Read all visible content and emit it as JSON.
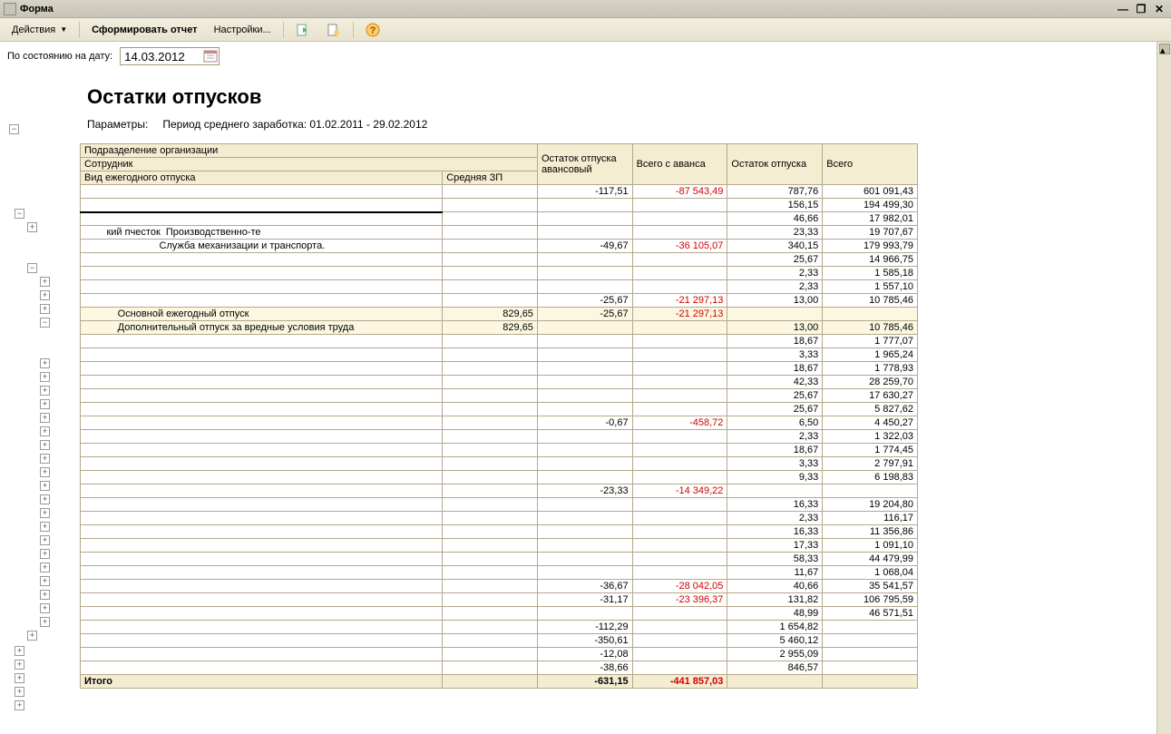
{
  "window": {
    "title": "Форма"
  },
  "toolbar": {
    "actions": "Действия",
    "generate": "Сформировать отчет",
    "settings": "Настройки..."
  },
  "dateRow": {
    "label": "По состоянию на дату:",
    "value": "14.03.2012"
  },
  "report": {
    "title": "Остатки отпусков",
    "paramsLabel": "Параметры:",
    "paramsText": "Период среднего заработка: 01.02.2011 - 29.02.2012",
    "header": {
      "r1c1": "Подразделение организации",
      "r1c2": "Остаток отпуска авансовый",
      "r1c3": "Всего с аванса",
      "r1c4": "Остаток отпуска",
      "r1c5": "Всего",
      "r2c1": "Сотрудник",
      "r3c1": "Вид ежегодного отпуска",
      "r3c2": "Средняя ЗП"
    },
    "rows": [
      {
        "name": "",
        "sp": "",
        "c1": "-117,51",
        "c2": "-87 543,49",
        "c2neg": true,
        "c3": "787,76",
        "c4": "601 091,43"
      },
      {
        "name": "",
        "sp": "",
        "c1": "",
        "c2": "",
        "c3": "156,15",
        "c4": "194 499,30",
        "thick": true
      },
      {
        "name": "",
        "sp": "",
        "c1": "",
        "c2": "",
        "c3": "46,66",
        "c4": "17 982,01"
      },
      {
        "name": "        кий пчесток  Производственно-те",
        "sp": "",
        "c1": "",
        "c2": "",
        "c3": "23,33",
        "c4": "19 707,67"
      },
      {
        "name": "                           Служба механизации и транспорта.",
        "sp": "",
        "c1": "-49,67",
        "c2": "-36 105,07",
        "c2neg": true,
        "c3": "340,15",
        "c4": "179 993,79"
      },
      {
        "name": "",
        "sp": "",
        "c1": "",
        "c2": "",
        "c3": "25,67",
        "c4": "14 966,75"
      },
      {
        "name": "",
        "sp": "",
        "c1": "",
        "c2": "",
        "c3": "2,33",
        "c4": "1 585,18"
      },
      {
        "name": "",
        "sp": "",
        "c1": "",
        "c2": "",
        "c3": "2,33",
        "c4": "1 557,10"
      },
      {
        "name": "",
        "sp": "",
        "c1": "-25,67",
        "c2": "-21 297,13",
        "c2neg": true,
        "c3": "13,00",
        "c4": "10 785,46"
      },
      {
        "name": "            Основной ежегодный отпуск",
        "sp": "829,65",
        "c1": "-25,67",
        "c2": "-21 297,13",
        "c2neg": true,
        "c3": "",
        "c4": "",
        "hl": true
      },
      {
        "name": "            Дополнительный отпуск за вредные условия труда",
        "sp": "829,65",
        "c1": "",
        "c2": "",
        "c3": "13,00",
        "c4": "10 785,46",
        "hl": true
      },
      {
        "name": "",
        "sp": "",
        "c1": "",
        "c2": "",
        "c3": "18,67",
        "c4": "1 777,07"
      },
      {
        "name": "",
        "sp": "",
        "c1": "",
        "c2": "",
        "c3": "3,33",
        "c4": "1 965,24"
      },
      {
        "name": "",
        "sp": "",
        "c1": "",
        "c2": "",
        "c3": "18,67",
        "c4": "1 778,93"
      },
      {
        "name": "",
        "sp": "",
        "c1": "",
        "c2": "",
        "c3": "42,33",
        "c4": "28 259,70"
      },
      {
        "name": "",
        "sp": "",
        "c1": "",
        "c2": "",
        "c3": "25,67",
        "c4": "17 630,27"
      },
      {
        "name": "",
        "sp": "",
        "c1": "",
        "c2": "",
        "c3": "25,67",
        "c4": "5 827,62"
      },
      {
        "name": "",
        "sp": "",
        "c1": "-0,67",
        "c2": "-458,72",
        "c2neg": true,
        "c3": "6,50",
        "c4": "4 450,27"
      },
      {
        "name": "",
        "sp": "",
        "c1": "",
        "c2": "",
        "c3": "2,33",
        "c4": "1 322,03"
      },
      {
        "name": "",
        "sp": "",
        "c1": "",
        "c2": "",
        "c3": "18,67",
        "c4": "1 774,45"
      },
      {
        "name": "",
        "sp": "",
        "c1": "",
        "c2": "",
        "c3": "3,33",
        "c4": "2 797,91"
      },
      {
        "name": "",
        "sp": "",
        "c1": "",
        "c2": "",
        "c3": "9,33",
        "c4": "6 198,83"
      },
      {
        "name": "",
        "sp": "",
        "c1": "-23,33",
        "c2": "-14 349,22",
        "c2neg": true,
        "c3": "",
        "c4": ""
      },
      {
        "name": "",
        "sp": "",
        "c1": "",
        "c2": "",
        "c3": "16,33",
        "c4": "19 204,80"
      },
      {
        "name": "",
        "sp": "",
        "c1": "",
        "c2": "",
        "c3": "2,33",
        "c4": "116,17"
      },
      {
        "name": "",
        "sp": "",
        "c1": "",
        "c2": "",
        "c3": "16,33",
        "c4": "11 356,86"
      },
      {
        "name": "",
        "sp": "",
        "c1": "",
        "c2": "",
        "c3": "17,33",
        "c4": "1 091,10"
      },
      {
        "name": "",
        "sp": "",
        "c1": "",
        "c2": "",
        "c3": "58,33",
        "c4": "44 479,99"
      },
      {
        "name": "",
        "sp": "",
        "c1": "",
        "c2": "",
        "c3": "11,67",
        "c4": "1 068,04"
      },
      {
        "name": "",
        "sp": "",
        "c1": "-36,67",
        "c2": "-28 042,05",
        "c2neg": true,
        "c3": "40,66",
        "c4": "35 541,57"
      },
      {
        "name": "",
        "sp": "",
        "c1": "-31,17",
        "c2": "-23 396,37",
        "c2neg": true,
        "c3": "131,82",
        "c4": "106 795,59"
      },
      {
        "name": "",
        "sp": "",
        "c1": "",
        "c2": "",
        "c3": "48,99",
        "c4": "46 571,51"
      },
      {
        "name": "",
        "sp": "",
        "c1": "-112,29",
        "c2": "",
        "c3": "1 654,82",
        "c4": ""
      },
      {
        "name": "",
        "sp": "",
        "c1": "-350,61",
        "c2": "",
        "c3": "5 460,12",
        "c4": ""
      },
      {
        "name": "",
        "sp": "",
        "c1": "-12,08",
        "c2": "",
        "c3": "2 955,09",
        "c4": ""
      },
      {
        "name": "",
        "sp": "",
        "c1": "-38,66",
        "c2": "",
        "c3": "846,57",
        "c4": ""
      }
    ],
    "itogo": {
      "name": "Итого",
      "c1": "-631,15",
      "c2": "-441 857,03",
      "c2neg": true,
      "c3": "",
      "c4": ""
    }
  },
  "tree": {
    "top": [
      {
        "s": "−",
        "t": 55
      }
    ],
    "l0": [
      {
        "s": "−",
        "t": 148
      },
      {
        "s": "+",
        "t": 630
      },
      {
        "s": "+",
        "t": 645
      },
      {
        "s": "+",
        "t": 660
      },
      {
        "s": "+",
        "t": 675
      },
      {
        "s": "+",
        "t": 690
      }
    ],
    "l1": [
      {
        "s": "+",
        "t": 163
      },
      {
        "s": "−",
        "t": 208
      },
      {
        "s": "+",
        "t": 613
      }
    ],
    "l2": [
      {
        "s": "+",
        "t": 223
      },
      {
        "s": "+",
        "t": 238
      },
      {
        "s": "+",
        "t": 253
      },
      {
        "s": "−",
        "t": 268
      },
      {
        "s": "+",
        "t": 313
      },
      {
        "s": "+",
        "t": 328
      },
      {
        "s": "+",
        "t": 343
      },
      {
        "s": "+",
        "t": 358
      },
      {
        "s": "+",
        "t": 373
      },
      {
        "s": "+",
        "t": 388
      },
      {
        "s": "+",
        "t": 403
      },
      {
        "s": "+",
        "t": 418
      },
      {
        "s": "+",
        "t": 433
      },
      {
        "s": "+",
        "t": 448
      },
      {
        "s": "+",
        "t": 463
      },
      {
        "s": "+",
        "t": 478
      },
      {
        "s": "+",
        "t": 493
      },
      {
        "s": "+",
        "t": 508
      },
      {
        "s": "+",
        "t": 523
      },
      {
        "s": "+",
        "t": 538
      },
      {
        "s": "+",
        "t": 553
      },
      {
        "s": "+",
        "t": 568
      },
      {
        "s": "+",
        "t": 583
      },
      {
        "s": "+",
        "t": 598
      }
    ]
  }
}
